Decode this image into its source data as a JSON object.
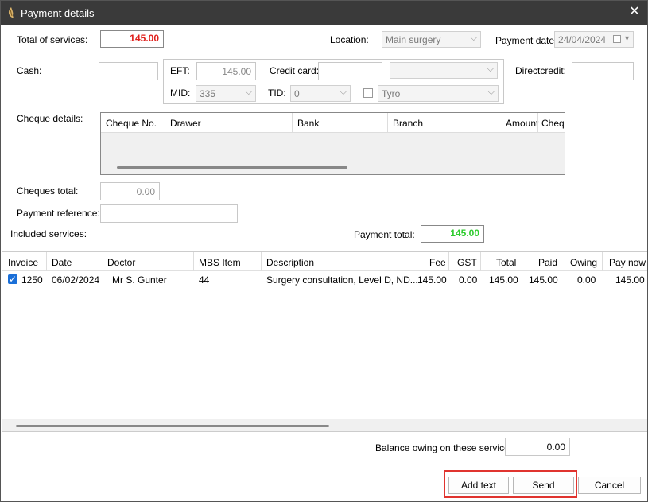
{
  "window": {
    "title": "Payment details",
    "close_glyph": "✕"
  },
  "form": {
    "total_services_label": "Total of services:",
    "total_services_value": "145.00",
    "location_label": "Location:",
    "location_value": "Main surgery",
    "payment_date_label": "Payment date:",
    "payment_date_value": "24/04/2024",
    "cash_label": "Cash:",
    "cash_value": "",
    "eft_label": "EFT:",
    "eft_value": "145.00",
    "credit_card_label": "Credit card:",
    "credit_card_value": "",
    "credit_card_type": "",
    "direct_credit_label": "Directcredit:",
    "direct_credit_value": "",
    "mid_label": "MID:",
    "mid_value": "335",
    "tid_label": "TID:",
    "tid_value": "0",
    "tyro_value": "Tyro",
    "tyro_checked": false,
    "cheque_details_label": "Cheque details:",
    "cheques_total_label": "Cheques total:",
    "cheques_total_value": "0.00",
    "payment_reference_label": "Payment reference:",
    "payment_reference_value": "",
    "included_services_label": "Included services:",
    "payment_total_label": "Payment total:",
    "payment_total_value": "145.00",
    "balance_label": "Balance owing on these services:",
    "balance_value": "0.00"
  },
  "cheque_grid": {
    "columns": [
      "Cheque No.",
      "Drawer",
      "Bank",
      "Branch",
      "Amount",
      "Chequ"
    ]
  },
  "services_grid": {
    "columns": [
      "Invoice",
      "Date",
      "Doctor",
      "MBS Item",
      "Description",
      "Fee",
      "GST",
      "Total",
      "Paid",
      "Owing",
      "Pay now"
    ],
    "rows": [
      {
        "checked": true,
        "invoice": "1250",
        "date": "06/02/2024",
        "doctor": "Mr S. Gunter",
        "mbs_item": "44",
        "description": "Surgery consultation, Level D, ND...",
        "fee": "145.00",
        "gst": "0.00",
        "total": "145.00",
        "paid": "145.00",
        "owing": "0.00",
        "pay_now": "145.00"
      }
    ]
  },
  "buttons": {
    "add_text": "Add text",
    "send": "Send",
    "cancel": "Cancel"
  },
  "colors": {
    "total_red": "#e0201c",
    "payment_total_green": "#2ecc2e",
    "highlight": "#e0342f",
    "checkbox_blue": "#1a6fd8"
  }
}
